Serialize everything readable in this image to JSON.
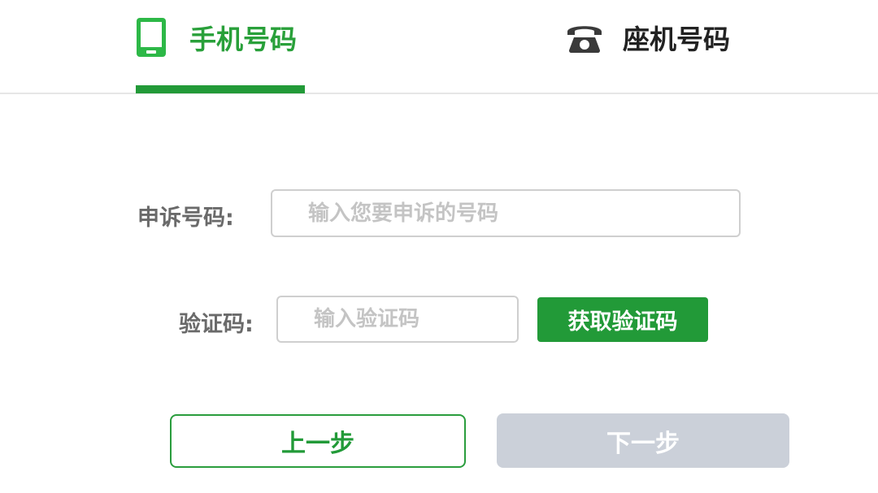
{
  "tabs": [
    {
      "label": "手机号码",
      "icon": "mobile-phone-icon",
      "active": true
    },
    {
      "label": "座机号码",
      "icon": "landline-phone-icon",
      "active": false
    }
  ],
  "colors": {
    "accent": "#229a38",
    "disabled": "#cbd0d9",
    "label_text": "#6a6a6a",
    "input_border": "#cfcfcf"
  },
  "form": {
    "number_label": "申诉号码:",
    "number_placeholder": "输入您要申诉的号码",
    "number_value": "",
    "code_label": "验证码:",
    "code_placeholder": "输入验证码",
    "code_value": "",
    "get_code_label": "获取验证码"
  },
  "actions": {
    "prev_label": "上一步",
    "next_label": "下一步",
    "next_enabled": false
  }
}
